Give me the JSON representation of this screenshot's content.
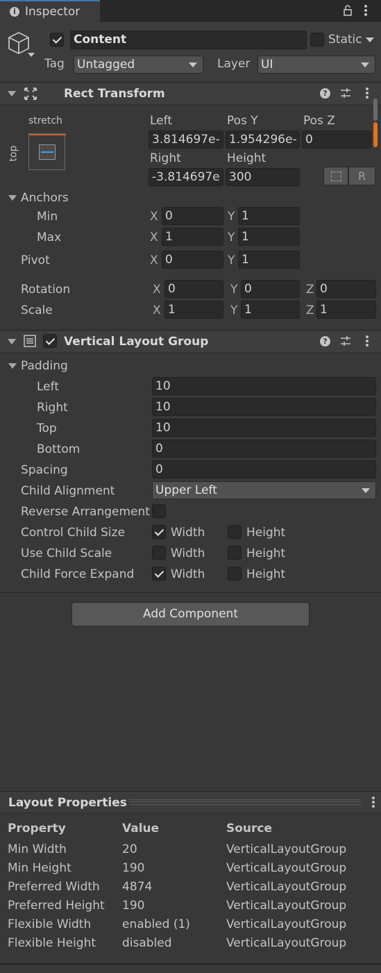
{
  "tab": {
    "title": "Inspector"
  },
  "object": {
    "name": "Content",
    "active": true,
    "static_label": "Static",
    "tag_label": "Tag",
    "tag_value": "Untagged",
    "layer_label": "Layer",
    "layer_value": "UI"
  },
  "rect_transform": {
    "title": "Rect Transform",
    "anchor_preset_h": "stretch",
    "anchor_preset_v": "top",
    "left_label": "Left",
    "left_value": "3.814697e-",
    "posy_label": "Pos Y",
    "posy_value": "1.954296e-",
    "posz_label": "Pos Z",
    "posz_value": "0",
    "right_label": "Right",
    "right_value": "-3.814697e",
    "height_label": "Height",
    "height_value": "300",
    "raw_button": "R",
    "anchors_label": "Anchors",
    "min_label": "Min",
    "min_x": "0",
    "min_y": "1",
    "max_label": "Max",
    "max_x": "1",
    "max_y": "1",
    "pivot_label": "Pivot",
    "pivot_x": "0",
    "pivot_y": "1",
    "rotation_label": "Rotation",
    "rot_x": "0",
    "rot_y": "0",
    "rot_z": "0",
    "scale_label": "Scale",
    "scale_x": "1",
    "scale_y": "1",
    "scale_z": "1",
    "x": "X",
    "y": "Y",
    "z": "Z"
  },
  "vlg": {
    "title": "Vertical Layout Group",
    "enabled": true,
    "padding_label": "Padding",
    "left_label": "Left",
    "left_value": "10",
    "right_label": "Right",
    "right_value": "10",
    "top_label": "Top",
    "top_value": "10",
    "bottom_label": "Bottom",
    "bottom_value": "0",
    "spacing_label": "Spacing",
    "spacing_value": "0",
    "child_alignment_label": "Child Alignment",
    "child_alignment_value": "Upper Left",
    "reverse_label": "Reverse Arrangement",
    "control_size_label": "Control Child Size",
    "use_scale_label": "Use Child Scale",
    "force_expand_label": "Child Force Expand",
    "width_label": "Width",
    "height_label": "Height"
  },
  "add_component": "Add Component",
  "layout_properties": {
    "title": "Layout Properties",
    "headers": [
      "Property",
      "Value",
      "Source"
    ],
    "rows": [
      [
        "Min Width",
        "20",
        "VerticalLayoutGroup"
      ],
      [
        "Min Height",
        "190",
        "VerticalLayoutGroup"
      ],
      [
        "Preferred Width",
        "4874",
        "VerticalLayoutGroup"
      ],
      [
        "Preferred Height",
        "190",
        "VerticalLayoutGroup"
      ],
      [
        "Flexible Width",
        "enabled (1)",
        "VerticalLayoutGroup"
      ],
      [
        "Flexible Height",
        "disabled",
        "VerticalLayoutGroup"
      ]
    ]
  }
}
